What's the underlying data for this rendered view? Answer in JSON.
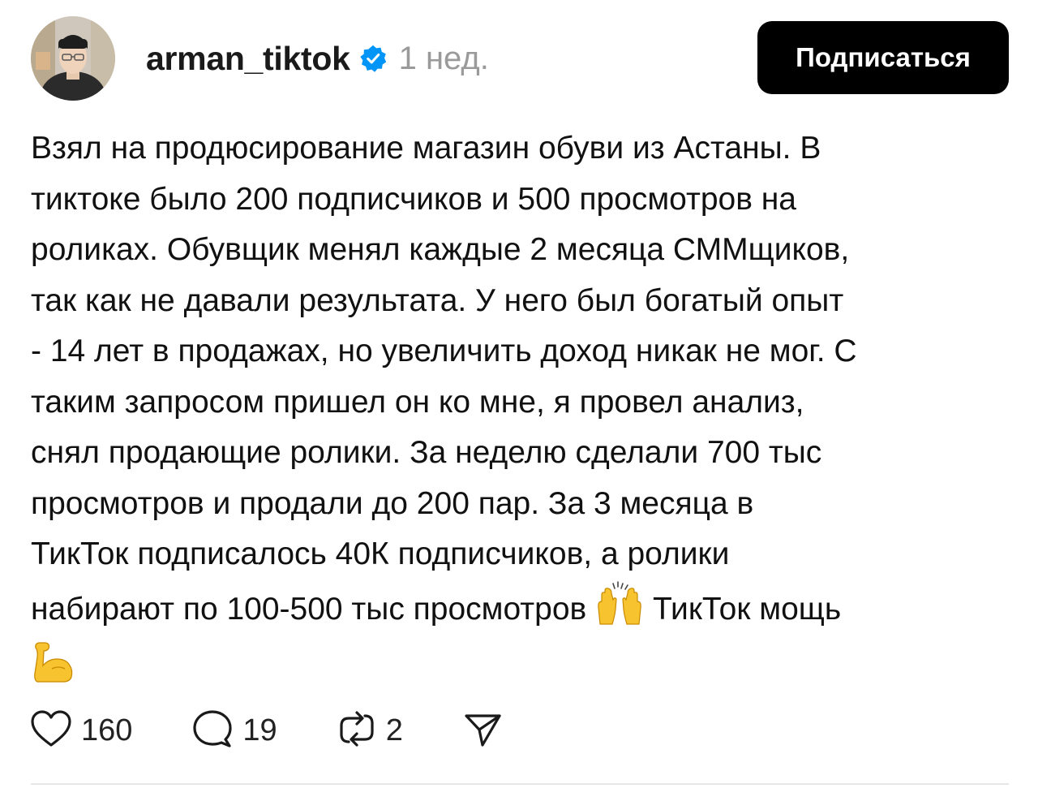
{
  "post": {
    "username": "arman_tiktok",
    "time_ago": "1 нед.",
    "follow_label": "Подписаться",
    "text_lines": [
      "Взял на продюсирование магазин обуви из Астаны. В",
      "тиктоке было 200 подписчиков и 500 просмотров на",
      "роликах. Обувщик менял каждые 2 месяца СММщиков,",
      "так как не давали результата. У него был богатый опыт",
      "- 14 лет в продажах, но увеличить доход никак не мог. С",
      "таким запросом пришел он ко мне, я провел анализ,",
      "снял продающие ролики. За неделю сделали 700 тыс",
      "просмотров и продали до 200 пар. За 3 месяца в",
      "ТикТок подписалось 40К подписчиков, а ролики"
    ],
    "line_10_a": "набирают по 100-500 тыс просмотров",
    "line_10_b": "ТикТок мощь"
  },
  "actions": {
    "likes": "160",
    "comments": "19",
    "reposts": "2"
  },
  "icons": {
    "verified": "verified-badge-icon",
    "emoji_1": "raising-hands-emoji",
    "emoji_2": "flexed-biceps-emoji",
    "like": "heart-icon",
    "comment": "comment-bubble-icon",
    "repost": "repost-icon",
    "share": "send-icon"
  },
  "colors": {
    "verified_blue": "#0095f6",
    "button_bg": "#000000",
    "muted_text": "#9a9a9a"
  }
}
